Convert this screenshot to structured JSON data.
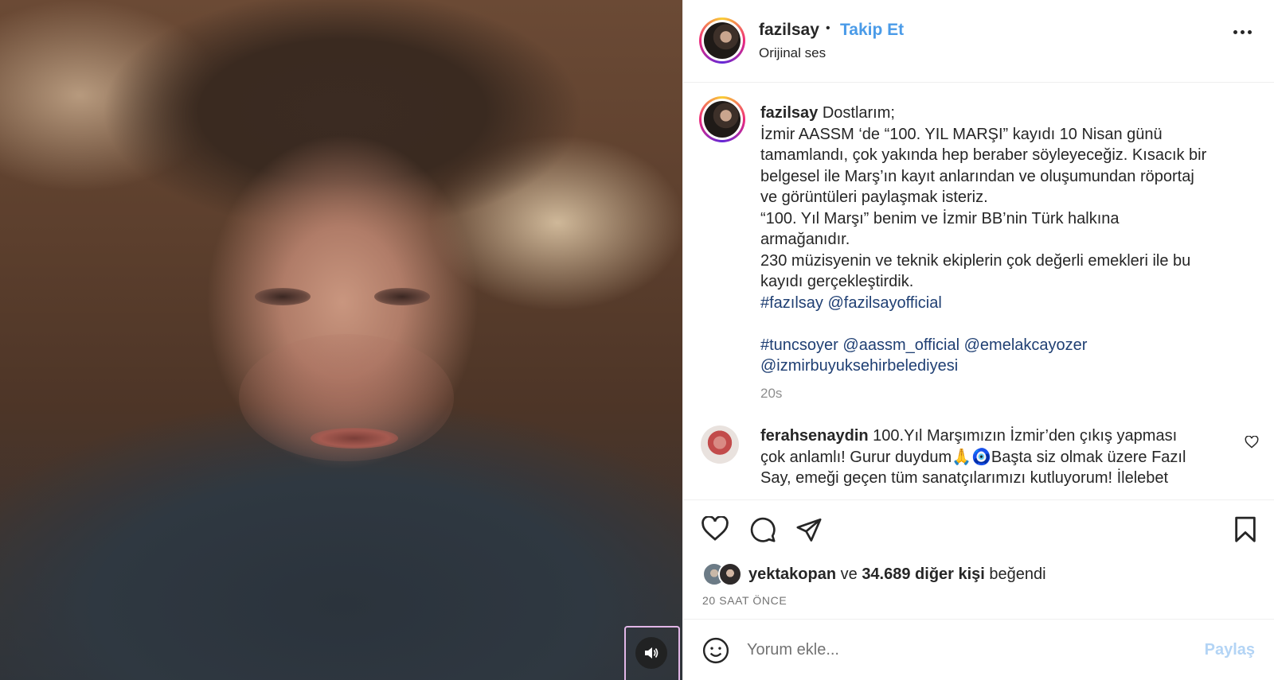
{
  "post": {
    "username": "fazilsay",
    "separator": "•",
    "follow_label": "Takip Et",
    "audio": "Orijinal ses",
    "more_icon": "more-horizontal-icon"
  },
  "caption": {
    "username": "fazilsay",
    "lines": [
      "Dostlarım;",
      "İzmir AASSM ‘de “100. YIL MARŞI” kayıdı 10 Nisan günü",
      "tamamlandı, çok yakında hep beraber söyleyeceğiz. Kısacık bir",
      "belgesel ile Marş’ın kayıt anlarından ve oluşumundan röportaj",
      "ve görüntüleri paylaşmak isteriz.",
      "“100. Yıl Marşı” benim ve İzmir BB’nin Türk halkına",
      "armağanıdır.",
      "230 müzisyenin ve teknik ekiplerin çok değerli emekleri ile bu",
      "kayıdı gerçekleştirdik."
    ],
    "tags_line1": "#fazılsay @fazilsayofficial",
    "tags_line2": "#tuncsoyer @aassm_official @emelakcayozer",
    "tags_line3": "@izmirbuyuksehirbelediyesi",
    "timestamp": "20s"
  },
  "comment": {
    "username": "ferahsenaydin",
    "line1": "100.Yıl Marşımızın İzmir’den çıkış yapması",
    "line2": "çok anlamlı! Gurur duydum🙏🧿Başta siz olmak üzere Fazıl",
    "line3": "Say, emeği geçen tüm sanatçılarımızı kutluyorum! İlelebet"
  },
  "likes": {
    "user": "yektakopan",
    "conj": "ve",
    "count_text": "34.689 diğer kişi",
    "suffix": "beğendi",
    "time": "20 SAAT ÖNCE"
  },
  "add_comment": {
    "placeholder": "Yorum ekle...",
    "share_label": "Paylaş"
  },
  "colors": {
    "follow": "#4a9be8",
    "hashtag": "#1f3f73",
    "share_disabled": "#b3d4f5"
  }
}
